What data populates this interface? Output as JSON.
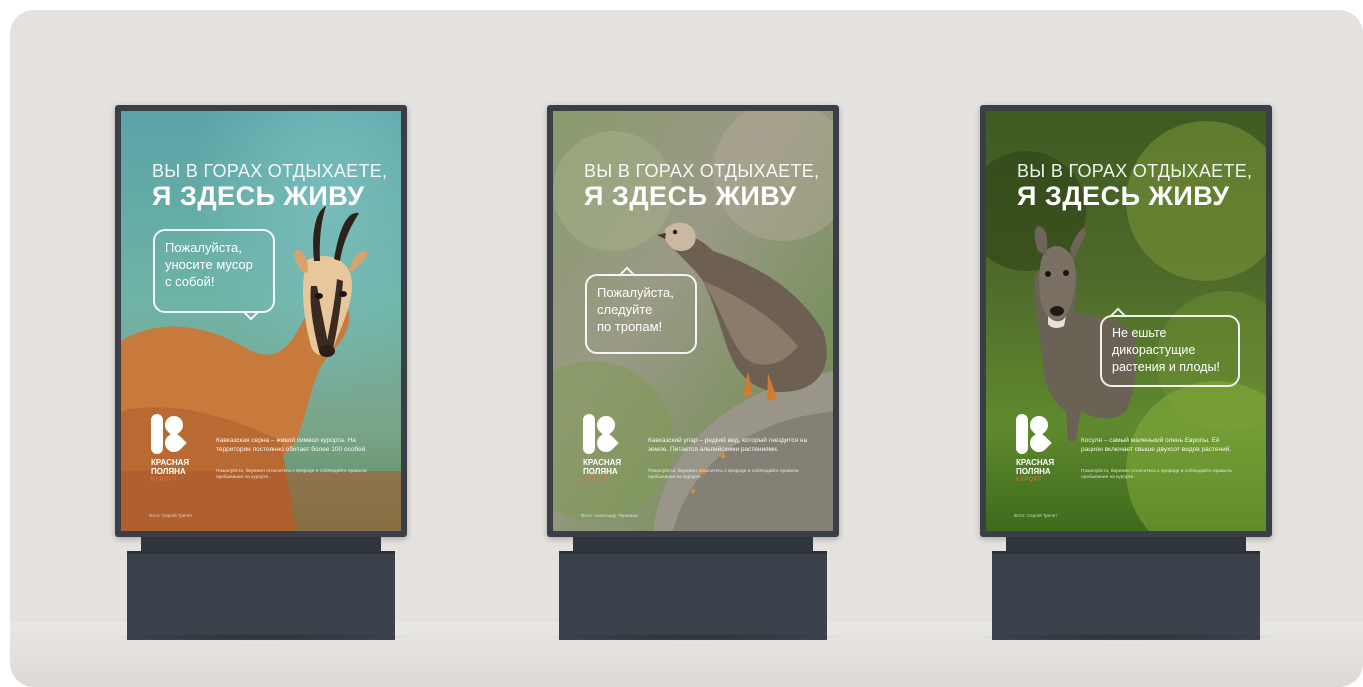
{
  "posters": [
    {
      "headline_line1": "ВЫ В ГОРАХ ОТДЫХАЕТЕ,",
      "headline_line2": "Я ЗДЕСЬ ЖИВУ",
      "bubble": [
        "Пожалуйста,",
        "уносите мусор",
        "с собой!"
      ],
      "brand_line1": "КРАСНАЯ",
      "brand_line2": "ПОЛЯНА",
      "brand_line3": "КУРОРТ",
      "description": "Кавказская серна – живой символ курорта. На территории постоянно обитает более 100 особей.",
      "fine_print": "Пожалуйста, бережно относитесь к природе и соблюдайте правила пребывания на курорте.",
      "credit": "Фото: Сергей Трепет",
      "animal_icon": "chamois-image"
    },
    {
      "headline_line1": "ВЫ В ГОРАХ ОТДЫХАЕТЕ,",
      "headline_line2": "Я ЗДЕСЬ ЖИВУ",
      "bubble": [
        "Пожалуйста,",
        "следуйте",
        "по тропам!"
      ],
      "brand_line1": "КРАСНАЯ",
      "brand_line2": "ПОЛЯНА",
      "brand_line3": "КУРОРТ",
      "description": "Кавказский улар – редкий вид, который гнездится на земле. Питается альпийскими растениями.",
      "fine_print": "Пожалуйста, бережно относитесь к природе и соблюдайте правила пребывания на курорте.",
      "credit": "Фото: Александр Черников",
      "animal_icon": "snowcock-image"
    },
    {
      "headline_line1": "ВЫ В ГОРАХ ОТДЫХАЕТЕ,",
      "headline_line2": "Я ЗДЕСЬ ЖИВУ",
      "bubble": [
        "Не ешьте",
        "дикорастущие",
        "растения и плоды!"
      ],
      "brand_line1": "КРАСНАЯ",
      "brand_line2": "ПОЛЯНА",
      "brand_line3": "КУРОРТ",
      "description": "Косуля – самый маленький олень Европы. Её рацион включает свыше двухсот видов растений.",
      "fine_print": "Пожалуйста, бережно относитесь к природе и соблюдайте правила пребывания на курорте.",
      "credit": "Фото: Сергей Трепет",
      "animal_icon": "roe-deer-image"
    }
  ],
  "colors": {
    "scene_bg": "#e4e1de",
    "frame": "#3a3f47",
    "base": "#3c424b",
    "brand_accent": "#e36e4a"
  }
}
